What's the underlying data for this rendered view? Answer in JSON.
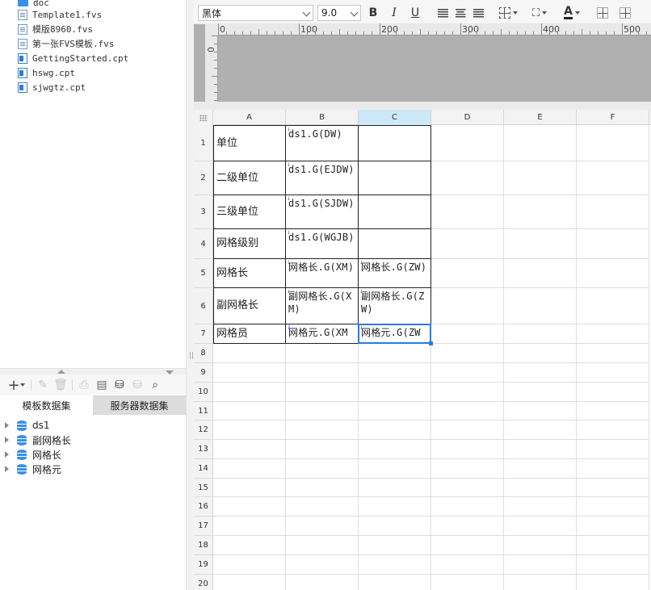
{
  "file_tree": {
    "items": [
      {
        "name": "doc",
        "icon": "folder-icon"
      },
      {
        "name": "Template1.fvs",
        "icon": "fvs-file-icon"
      },
      {
        "name": "模版8960.fvs",
        "icon": "fvs-file-icon"
      },
      {
        "name": "第一张FVS模板.fvs",
        "icon": "fvs-file-icon"
      },
      {
        "name": "GettingStarted.cpt",
        "icon": "cpt-file-icon"
      },
      {
        "name": "hswg.cpt",
        "icon": "cpt-file-icon"
      },
      {
        "name": "sjwgtz.cpt",
        "icon": "cpt-file-icon"
      }
    ]
  },
  "dataset_toolbar": {
    "icons": [
      "add-icon",
      "edit-icon",
      "delete-icon",
      "preview-icon",
      "dataset-edit-icon",
      "database-icon",
      "database-disabled-icon",
      "search-icon"
    ]
  },
  "dataset_tabs": {
    "template": "模板数据集",
    "server": "服务器数据集"
  },
  "datasets": [
    {
      "label": "ds1"
    },
    {
      "label": "副网格长"
    },
    {
      "label": "网格长"
    },
    {
      "label": "网格元"
    }
  ],
  "toolbar": {
    "font": "黑体",
    "size": "9.0",
    "bold": "B",
    "italic": "I",
    "underline": "U",
    "font_color_label": "A"
  },
  "ruler": {
    "top_labels": [
      "0",
      "100",
      "200",
      "300",
      "400",
      "500"
    ],
    "left_label": "0"
  },
  "sheet": {
    "columns": [
      "A",
      "B",
      "C",
      "D",
      "E",
      "F"
    ],
    "rows": [
      "1",
      "2",
      "3",
      "4",
      "5",
      "6",
      "7",
      "8",
      "9",
      "10",
      "11",
      "12",
      "13",
      "14",
      "15",
      "16",
      "17",
      "18",
      "19",
      "20"
    ],
    "cells": {
      "A1": "单位",
      "B1": "ds1.G(DW)",
      "C1": "",
      "A2": "二级单位",
      "B2": "ds1.G(EJDW)",
      "C2": "",
      "A3": "三级单位",
      "B3": "ds1.G(SJDW)",
      "C3": "",
      "A4": "网格级别",
      "B4": "ds1.G(WGJB)",
      "C4": "",
      "A5": "网格长",
      "B5": "网格长.G(XM)",
      "C5": "网格长.G(ZW)",
      "A6": "副网格长",
      "B6": "副网格长.G(XM)",
      "C6": "副网格长.G(ZW)",
      "A7": "网格员",
      "B7": "网格元.G(XM",
      "C7": "网格元.G(ZW"
    },
    "selected_cell": "C7",
    "selected_column": "C"
  },
  "colors": {
    "selection": "#2b7bd8",
    "selected_header": "#cde8f6",
    "dataset_icon": "#3c8fe6"
  }
}
